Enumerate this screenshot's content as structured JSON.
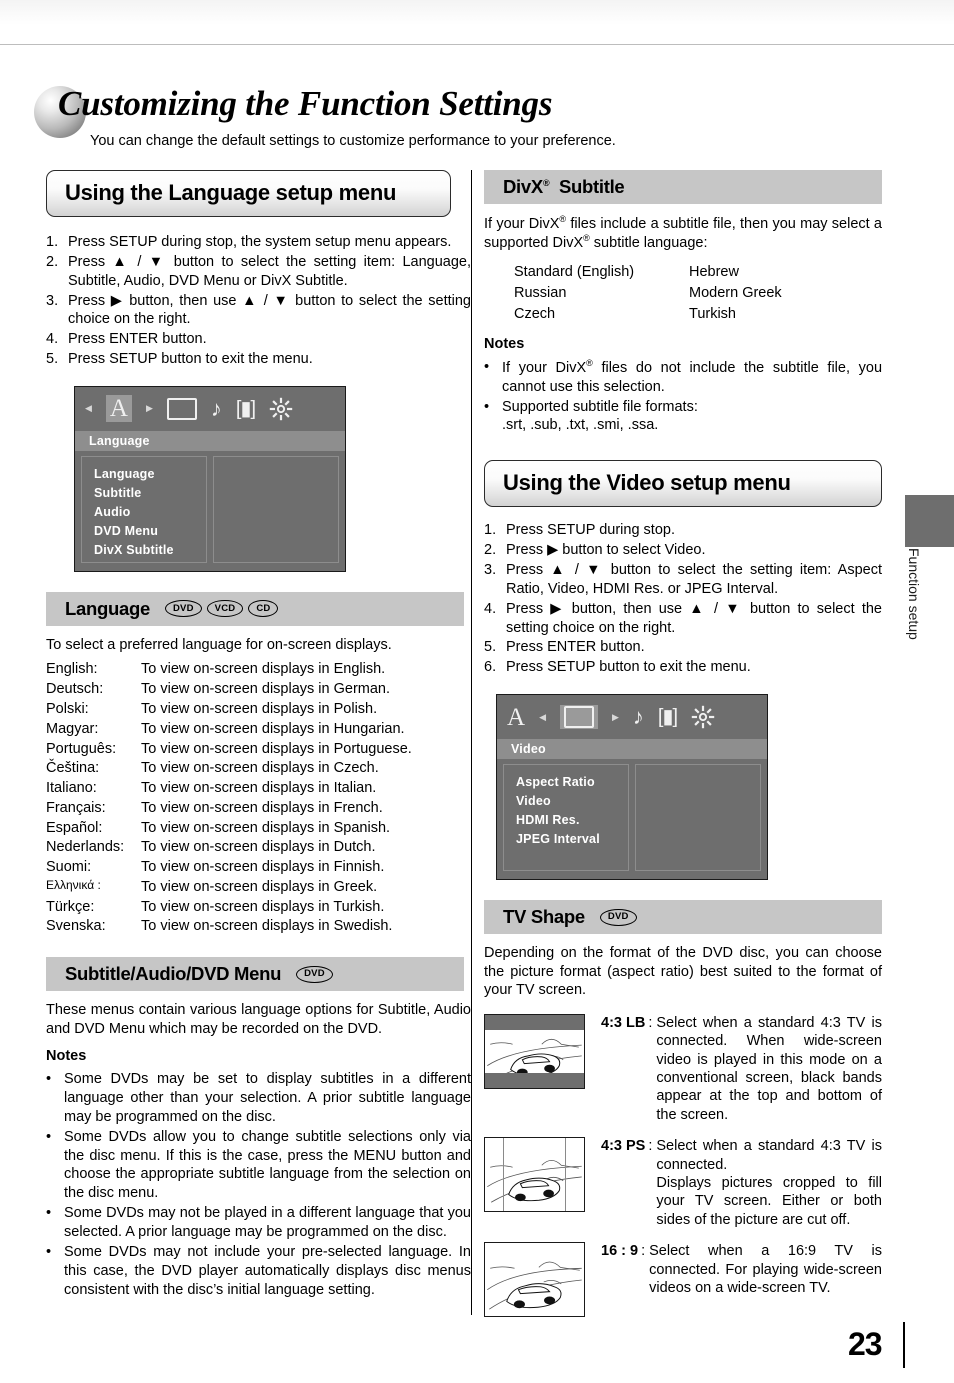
{
  "page": {
    "title": "Customizing the Function Settings",
    "subtitle": "You can change the default settings to customize performance to your preference.",
    "number": "23",
    "side_tab_label": "Function setup"
  },
  "language_setup": {
    "banner": "Using the Language setup menu",
    "steps": [
      {
        "num": "1.",
        "text": "Press SETUP during stop, the system setup menu appears."
      },
      {
        "num": "2.",
        "text": "Press ▲ / ▼ button to select the setting item: Language, Subtitle, Audio, DVD Menu or DivX Subtitle."
      },
      {
        "num": "3.",
        "text": "Press ▶ button, then use ▲ / ▼ button to select the setting choice on the right."
      },
      {
        "num": "4.",
        "text": "Press ENTER button."
      },
      {
        "num": "5.",
        "text": "Press SETUP button to exit the menu."
      }
    ],
    "osd": {
      "selected_icon": "A",
      "title": "Language",
      "items": [
        "Language",
        "Subtitle",
        "Audio",
        "DVD Menu",
        "DivX Subtitle"
      ]
    }
  },
  "language_section": {
    "heading": "Language",
    "badges": [
      "DVD",
      "VCD",
      "CD"
    ],
    "intro": "To select a preferred language for on-screen displays.",
    "rows": [
      {
        "name": "English:",
        "desc": "To view on-screen displays in English."
      },
      {
        "name": "Deutsch:",
        "desc": "To view on-screen displays in German."
      },
      {
        "name": "Polski:",
        "desc": "To view on-screen displays in Polish."
      },
      {
        "name": "Magyar:",
        "desc": "To view on-screen displays in Hungarian."
      },
      {
        "name": "Português:",
        "desc": "To view on-screen displays in Portuguese."
      },
      {
        "name": "Čeština:",
        "desc": "To view on-screen displays in Czech."
      },
      {
        "name": "Italiano:",
        "desc": "To view on-screen displays in Italian."
      },
      {
        "name": "Français:",
        "desc": "To view on-screen displays in French."
      },
      {
        "name": "Español:",
        "desc": "To view on-screen displays in Spanish."
      },
      {
        "name": "Nederlands:",
        "desc": "To view on-screen displays in Dutch."
      },
      {
        "name": "Suomi:",
        "desc": "To view on-screen displays in Finnish."
      },
      {
        "name": "Ελληνικά :",
        "desc": "To view on-screen displays in Greek."
      },
      {
        "name": "Türkçe:",
        "desc": "To view on-screen displays in Turkish."
      },
      {
        "name": "Svenska:",
        "desc": "To view on-screen displays in Swedish."
      }
    ]
  },
  "subtitle_section": {
    "heading": "Subtitle/Audio/DVD Menu",
    "badges": [
      "DVD"
    ],
    "body": "These menus contain various language options for Subtitle, Audio and DVD Menu which may be recorded on the DVD.",
    "notes_label": "Notes",
    "notes": [
      "Some DVDs may be set to display subtitles in a different language other than your selection. A prior subtitle language may be programmed on the disc.",
      "Some DVDs allow you to change subtitle selections only via the disc menu. If this is the case, press the MENU button and choose the appropriate subtitle language from the selection on the disc menu.",
      "Some DVDs may not be played in a different language that you selected. A prior language may be programmed on the disc.",
      "Some DVDs may not include your pre-selected language. In this case, the DVD player automatically displays disc menus consistent with the disc’s initial language setting."
    ]
  },
  "divx_subtitle": {
    "heading_main": "DivX",
    "heading_reg": "®",
    "heading_rest": "Subtitle",
    "intro_1": "If your DivX",
    "intro_2": " files include a subtitle file, then you may select a supported DivX",
    "intro_3": " subtitle language:",
    "languages": [
      {
        "left": "Standard (English)",
        "right": "Hebrew"
      },
      {
        "left": "Russian",
        "right": "Modern Greek"
      },
      {
        "left": "Czech",
        "right": "Turkish"
      }
    ],
    "notes_label": "Notes",
    "note1_a": "If your DivX",
    "note1_b": " files do not include the subtitle file, you cannot use this selection.",
    "note2_line1": "Supported subtitle file formats:",
    "note2_line2": ".srt, .sub, .txt, .smi, .ssa."
  },
  "video_setup": {
    "banner": "Using the Video setup menu",
    "steps": [
      {
        "num": "1.",
        "text": "Press SETUP during stop."
      },
      {
        "num": "2.",
        "text": "Press ▶ button to select Video."
      },
      {
        "num": "3.",
        "text": "Press ▲ / ▼ button to select the setting item: Aspect Ratio, Video, HDMI Res. or JPEG Interval."
      },
      {
        "num": "4.",
        "text": "Press ▶ button, then use ▲ / ▼ button to select the setting choice on the right."
      },
      {
        "num": "5.",
        "text": "Press ENTER button."
      },
      {
        "num": "6.",
        "text": "Press SETUP button to exit the menu."
      }
    ],
    "osd": {
      "first_icon": "A",
      "title": "Video",
      "items": [
        "Aspect Ratio",
        "Video",
        "HDMI Res.",
        "JPEG Interval"
      ]
    }
  },
  "tv_shape": {
    "heading": "TV Shape",
    "badges": [
      "DVD"
    ],
    "intro": "Depending on the format of the DVD disc, you can choose the picture format (aspect ratio) best suited to the format of your TV screen.",
    "rows": [
      {
        "label": "4:3 LB",
        "colon": ":",
        "text": "Select when a standard 4:3 TV is connected. When wide-screen video is played in this mode on a conventional screen, black bands appear at the top and bottom of the screen.",
        "thumb_style": "letterbox"
      },
      {
        "label": "4:3 PS",
        "colon": ":",
        "text": "Select when a standard 4:3 TV is connected.\nDisplays pictures cropped to fill your TV screen. Either or both sides of the picture are cut off.",
        "thumb_style": "panscan"
      },
      {
        "label": "16 : 9",
        "colon": ":",
        "text": "Select when a 16:9 TV is connected. For playing wide-screen videos on a wide-screen TV.",
        "thumb_style": "wide"
      }
    ]
  },
  "colors": {
    "gray_heading": "#c6c6c6",
    "osd_bg": "#6e6e6e",
    "osd_title_bg": "#8e8e8e"
  }
}
